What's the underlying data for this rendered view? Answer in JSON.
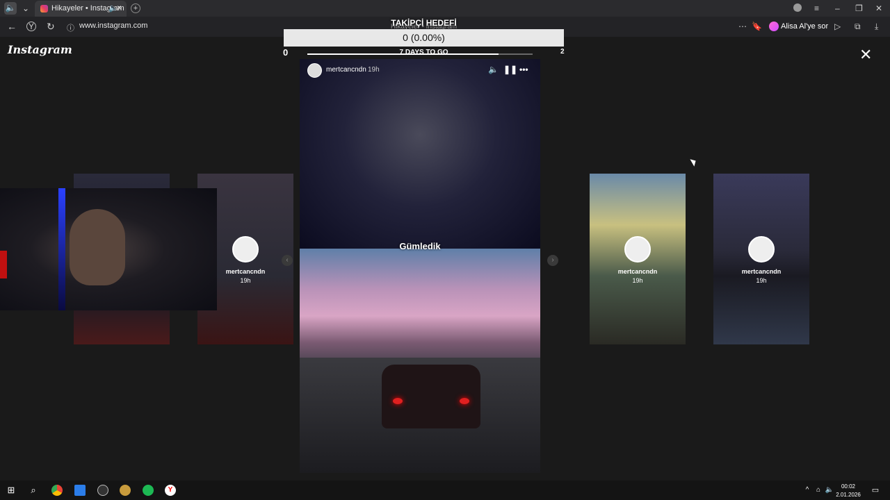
{
  "browser": {
    "tab_title": "Hikayeler • Instagram",
    "url": "www.instagram.com",
    "assistant_label": "Alisa Al'ye sor"
  },
  "goal": {
    "title": "TAKİPÇİ HEDEFİ",
    "ghost_title": "Hikayeler • Instagram",
    "value": "0 (0.00%)",
    "days_left": "7 DAYS TO GO",
    "min": "0",
    "max": "2"
  },
  "page": {
    "logo": "Instagram",
    "close": "✕"
  },
  "story": {
    "username": "mertcancndn",
    "time": "19h",
    "caption": "Gümledik",
    "progress": 0.85
  },
  "previews": [
    {
      "username": "mertcancndn",
      "time": "19h"
    },
    {
      "username": "mertcancndn",
      "time": "19h"
    },
    {
      "username": "mertcancndn",
      "time": "19h"
    }
  ],
  "taskbar": {
    "time": "00:02",
    "date": "2.01.2026"
  },
  "colors": {
    "accent": "#e4405f",
    "background": "#1a1a1a"
  }
}
